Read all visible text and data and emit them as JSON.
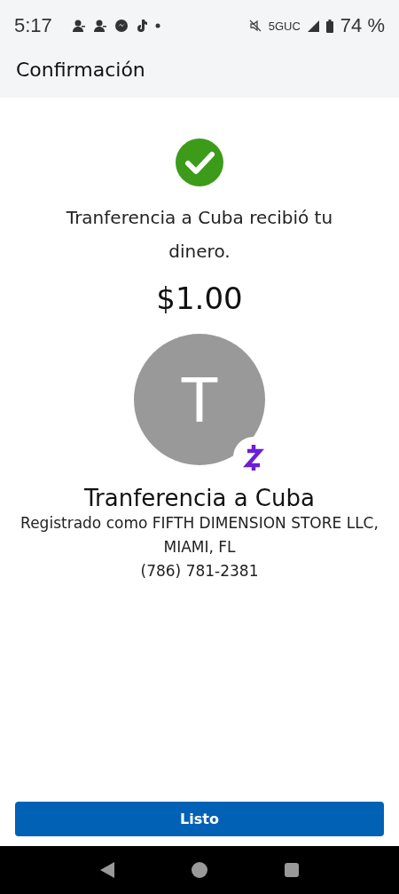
{
  "status_bar": {
    "time": "5:17",
    "network": "5GUC",
    "battery": "74 %"
  },
  "header": {
    "title": "Confirmación"
  },
  "message": "Tranferencia a Cuba recibió tu dinero.",
  "amount": "$1.00",
  "recipient": {
    "initial": "T",
    "name": "Tranferencia a Cuba",
    "registered": "Registrado como FIFTH DIMENSION STORE LLC, MIAMI, FL",
    "phone": "(786) 781-2381"
  },
  "button": {
    "label": "Listo"
  }
}
